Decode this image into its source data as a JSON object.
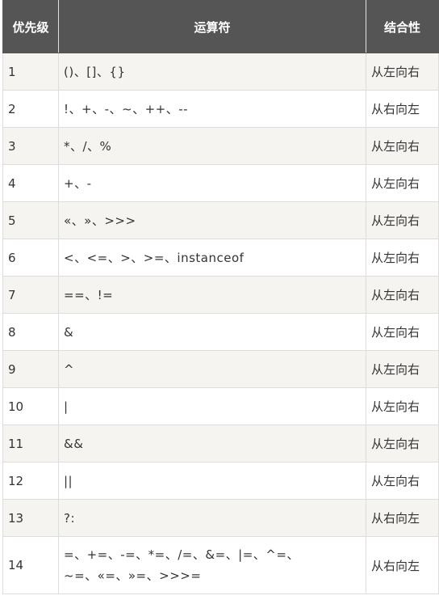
{
  "table": {
    "headers": [
      "优先级",
      "运算符",
      "结合性"
    ],
    "rows": [
      {
        "priority": "1",
        "operators": [
          "()、[]、{}"
        ],
        "assoc": "从左向右"
      },
      {
        "priority": "2",
        "operators": [
          "!、+、-、~、++、--"
        ],
        "assoc": "从右向左"
      },
      {
        "priority": "3",
        "operators": [
          "*、/、%"
        ],
        "assoc": "从左向右"
      },
      {
        "priority": "4",
        "operators": [
          "+、-"
        ],
        "assoc": "从左向右"
      },
      {
        "priority": "5",
        "operators": [
          "«、»、>>>"
        ],
        "assoc": "从左向右"
      },
      {
        "priority": "6",
        "operators": [
          "<、<=、>、>=、instanceof"
        ],
        "assoc": "从左向右"
      },
      {
        "priority": "7",
        "operators": [
          "==、!="
        ],
        "assoc": "从左向右"
      },
      {
        "priority": "8",
        "operators": [
          "&"
        ],
        "assoc": "从左向右"
      },
      {
        "priority": "9",
        "operators": [
          "^"
        ],
        "assoc": "从左向右"
      },
      {
        "priority": "10",
        "operators": [
          "|"
        ],
        "assoc": "从左向右"
      },
      {
        "priority": "11",
        "operators": [
          "&&"
        ],
        "assoc": "从左向右"
      },
      {
        "priority": "12",
        "operators": [
          "||"
        ],
        "assoc": "从左向右"
      },
      {
        "priority": "13",
        "operators": [
          "?:"
        ],
        "assoc": "从右向左"
      },
      {
        "priority": "14",
        "operators": [
          "=、+=、-=、*=、/=、&=、|=、^=、",
          "~=、«=、»=、>>>="
        ],
        "assoc": "从右向左"
      }
    ]
  }
}
